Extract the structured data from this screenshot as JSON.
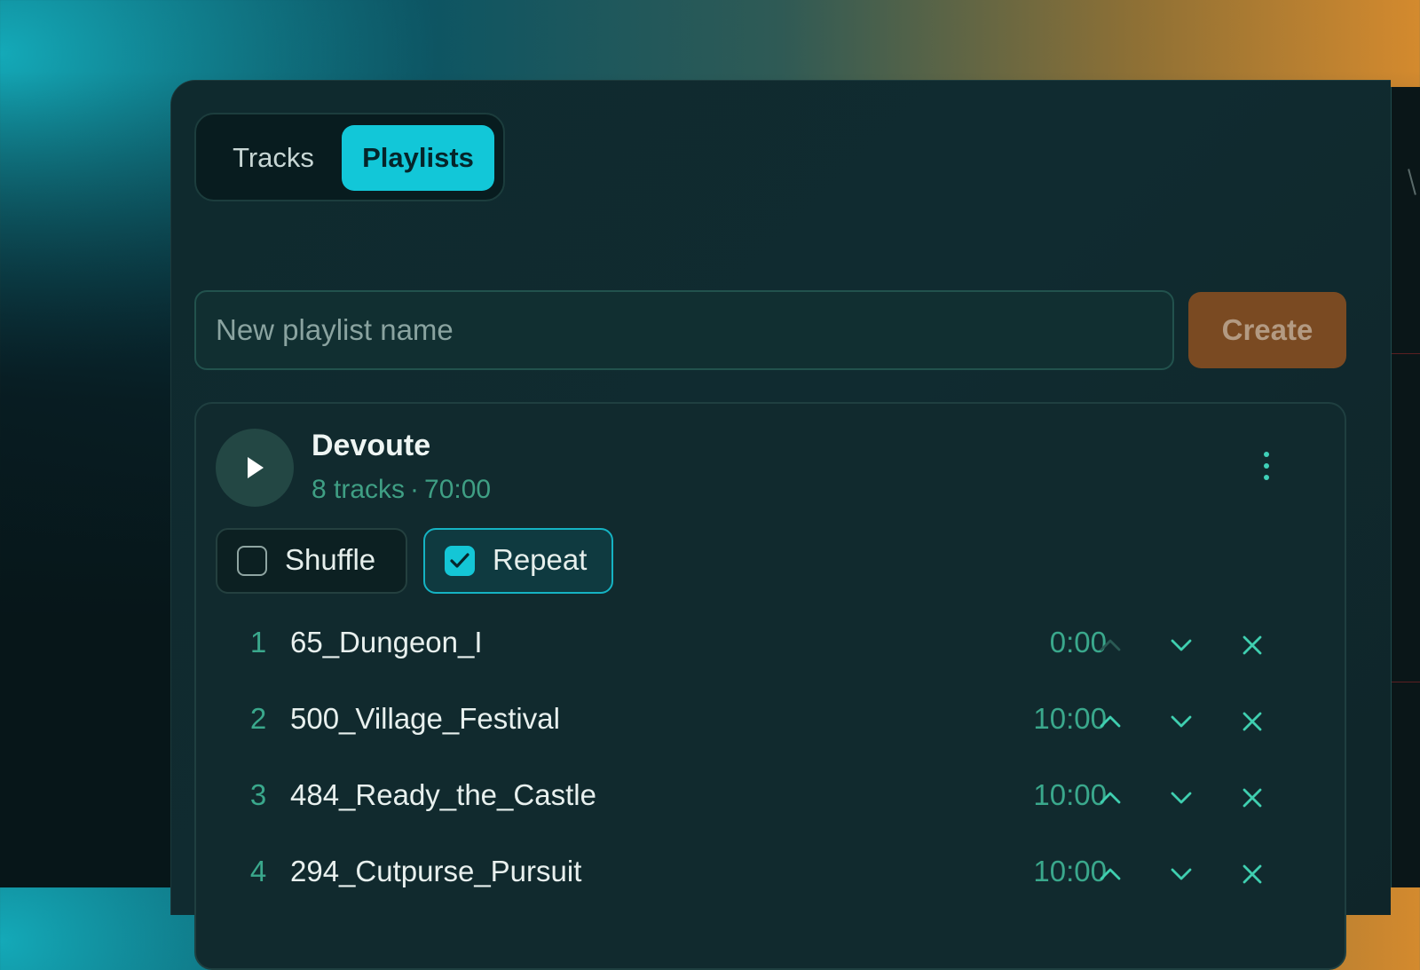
{
  "tabs": {
    "tracks_label": "Tracks",
    "playlists_label": "Playlists",
    "active": "Playlists"
  },
  "new_playlist": {
    "placeholder": "New playlist name",
    "value": "",
    "create_label": "Create"
  },
  "playlist": {
    "name": "Devoute",
    "track_count": "8 tracks",
    "meta_separator": "·",
    "total_duration": "70:00",
    "shuffle_label": "Shuffle",
    "shuffle_checked": false,
    "repeat_label": "Repeat",
    "repeat_checked": true,
    "tracks": [
      {
        "num": "1",
        "title": "65_Dungeon_I",
        "duration": "0:00"
      },
      {
        "num": "2",
        "title": "500_Village_Festival",
        "duration": "10:00"
      },
      {
        "num": "3",
        "title": "484_Ready_the_Castle",
        "duration": "10:00"
      },
      {
        "num": "4",
        "title": "294_Cutpurse_Pursuit",
        "duration": "10:00"
      }
    ]
  },
  "icons": {
    "play": "play-icon",
    "more": "kebab-menu-icon",
    "check": "check-icon",
    "move_up": "chevron-up-icon",
    "move_down": "chevron-down-icon",
    "remove": "close-icon"
  },
  "colors": {
    "accent": "#12c7d8",
    "create_button": "#7a4a22",
    "secondary_text": "#3aa88c"
  }
}
